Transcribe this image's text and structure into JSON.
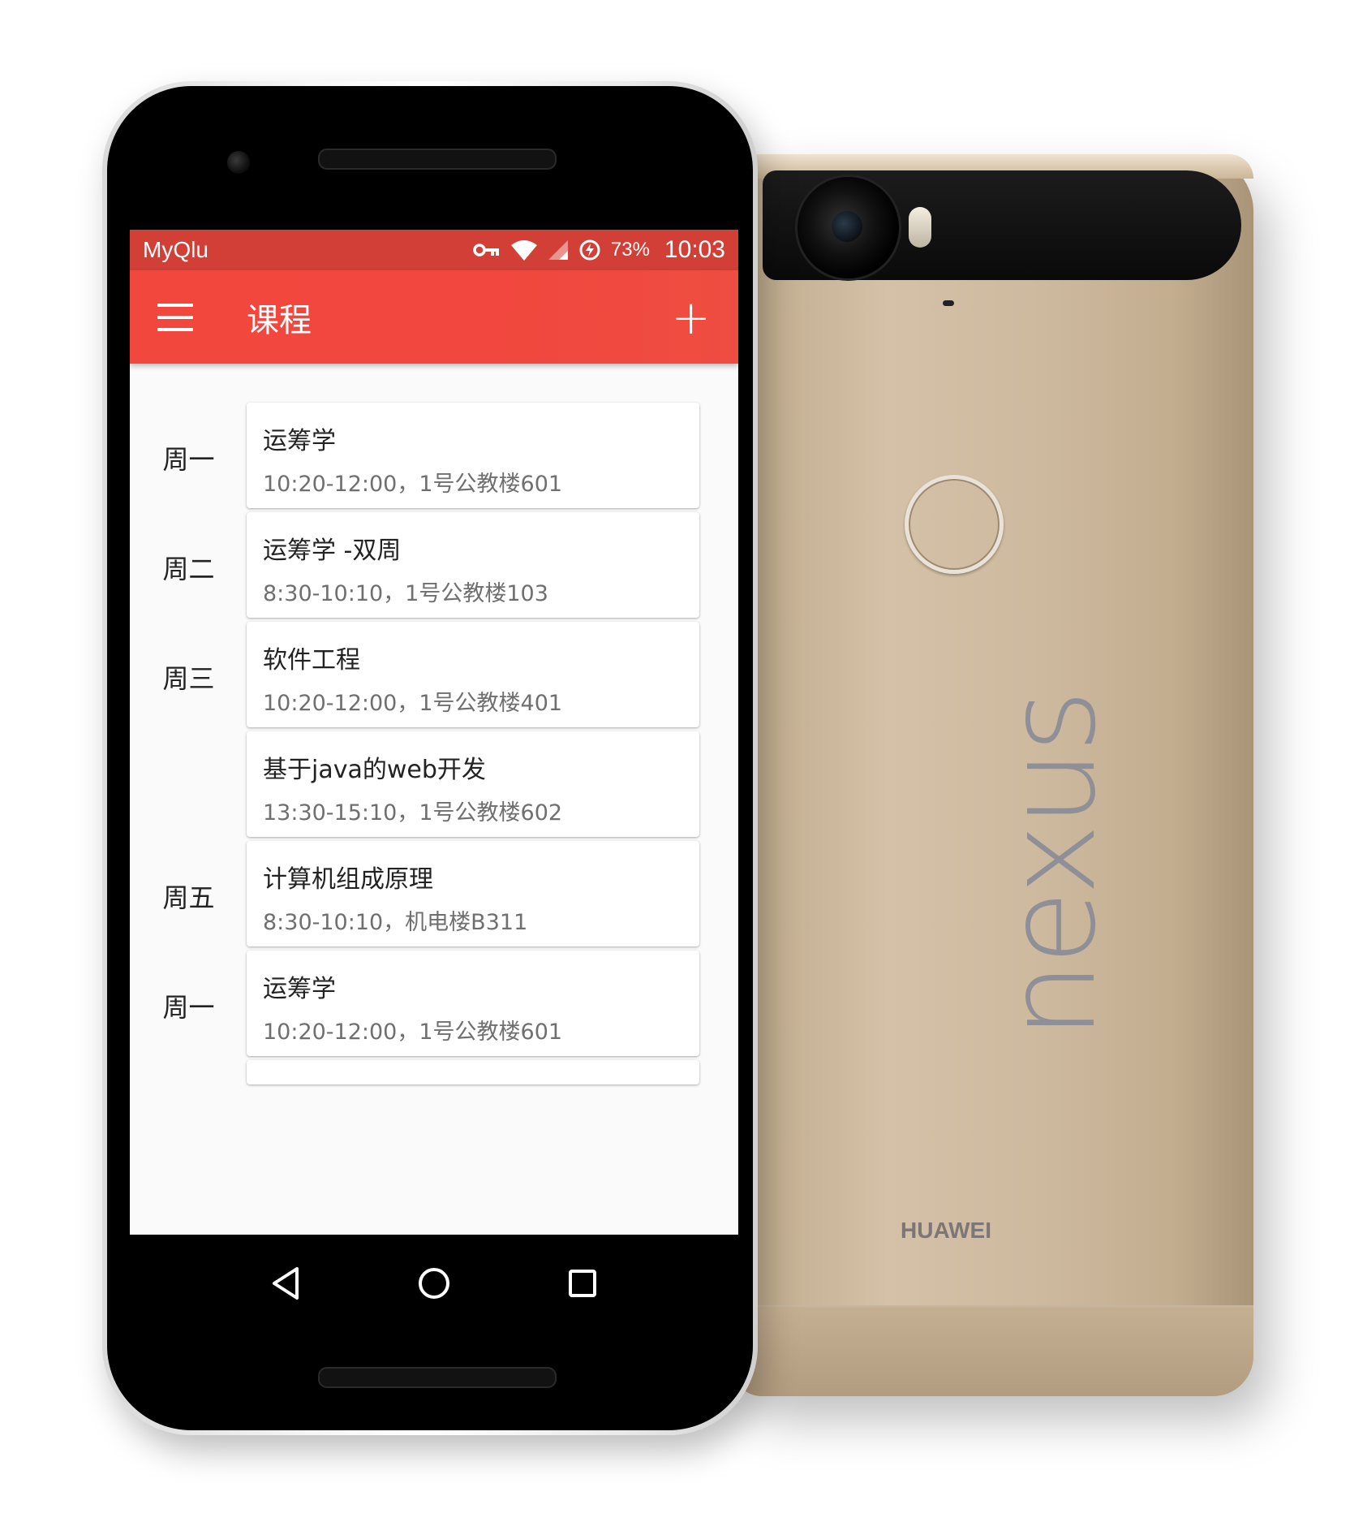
{
  "back_device": {
    "logo": "nexus",
    "brand": "HUAWEI",
    "body_color": "#cdb99e"
  },
  "status_bar": {
    "app_name": "MyQlu",
    "battery": "73%",
    "time": "10:03",
    "icons": [
      "vpn-key-icon",
      "wifi-icon",
      "cellular-signal-icon",
      "data-saver-icon"
    ],
    "color": "#d23f37"
  },
  "toolbar": {
    "title": "课程",
    "menu_icon": "menu-icon",
    "add_icon": "add-icon",
    "add_label": "+",
    "color": "#f2473d"
  },
  "courses": [
    {
      "day": "周一",
      "name": "运筹学",
      "detail": "10:20-12:00，1号公教楼601"
    },
    {
      "day": "周二",
      "name": "运筹学 -双周",
      "detail": "8:30-10:10，1号公教楼103"
    },
    {
      "day": "周三",
      "name": "软件工程",
      "detail": "10:20-12:00，1号公教楼401"
    },
    {
      "day": "",
      "name": "基于java的web开发",
      "detail": "13:30-15:10，1号公教楼602"
    },
    {
      "day": "周五",
      "name": "计算机组成原理",
      "detail": "8:30-10:10，机电楼B311"
    },
    {
      "day": "周一",
      "name": "运筹学",
      "detail": "10:20-12:00，1号公教楼601"
    }
  ],
  "nav_bar": {
    "icons": [
      "back-icon",
      "home-icon",
      "recents-icon"
    ]
  }
}
